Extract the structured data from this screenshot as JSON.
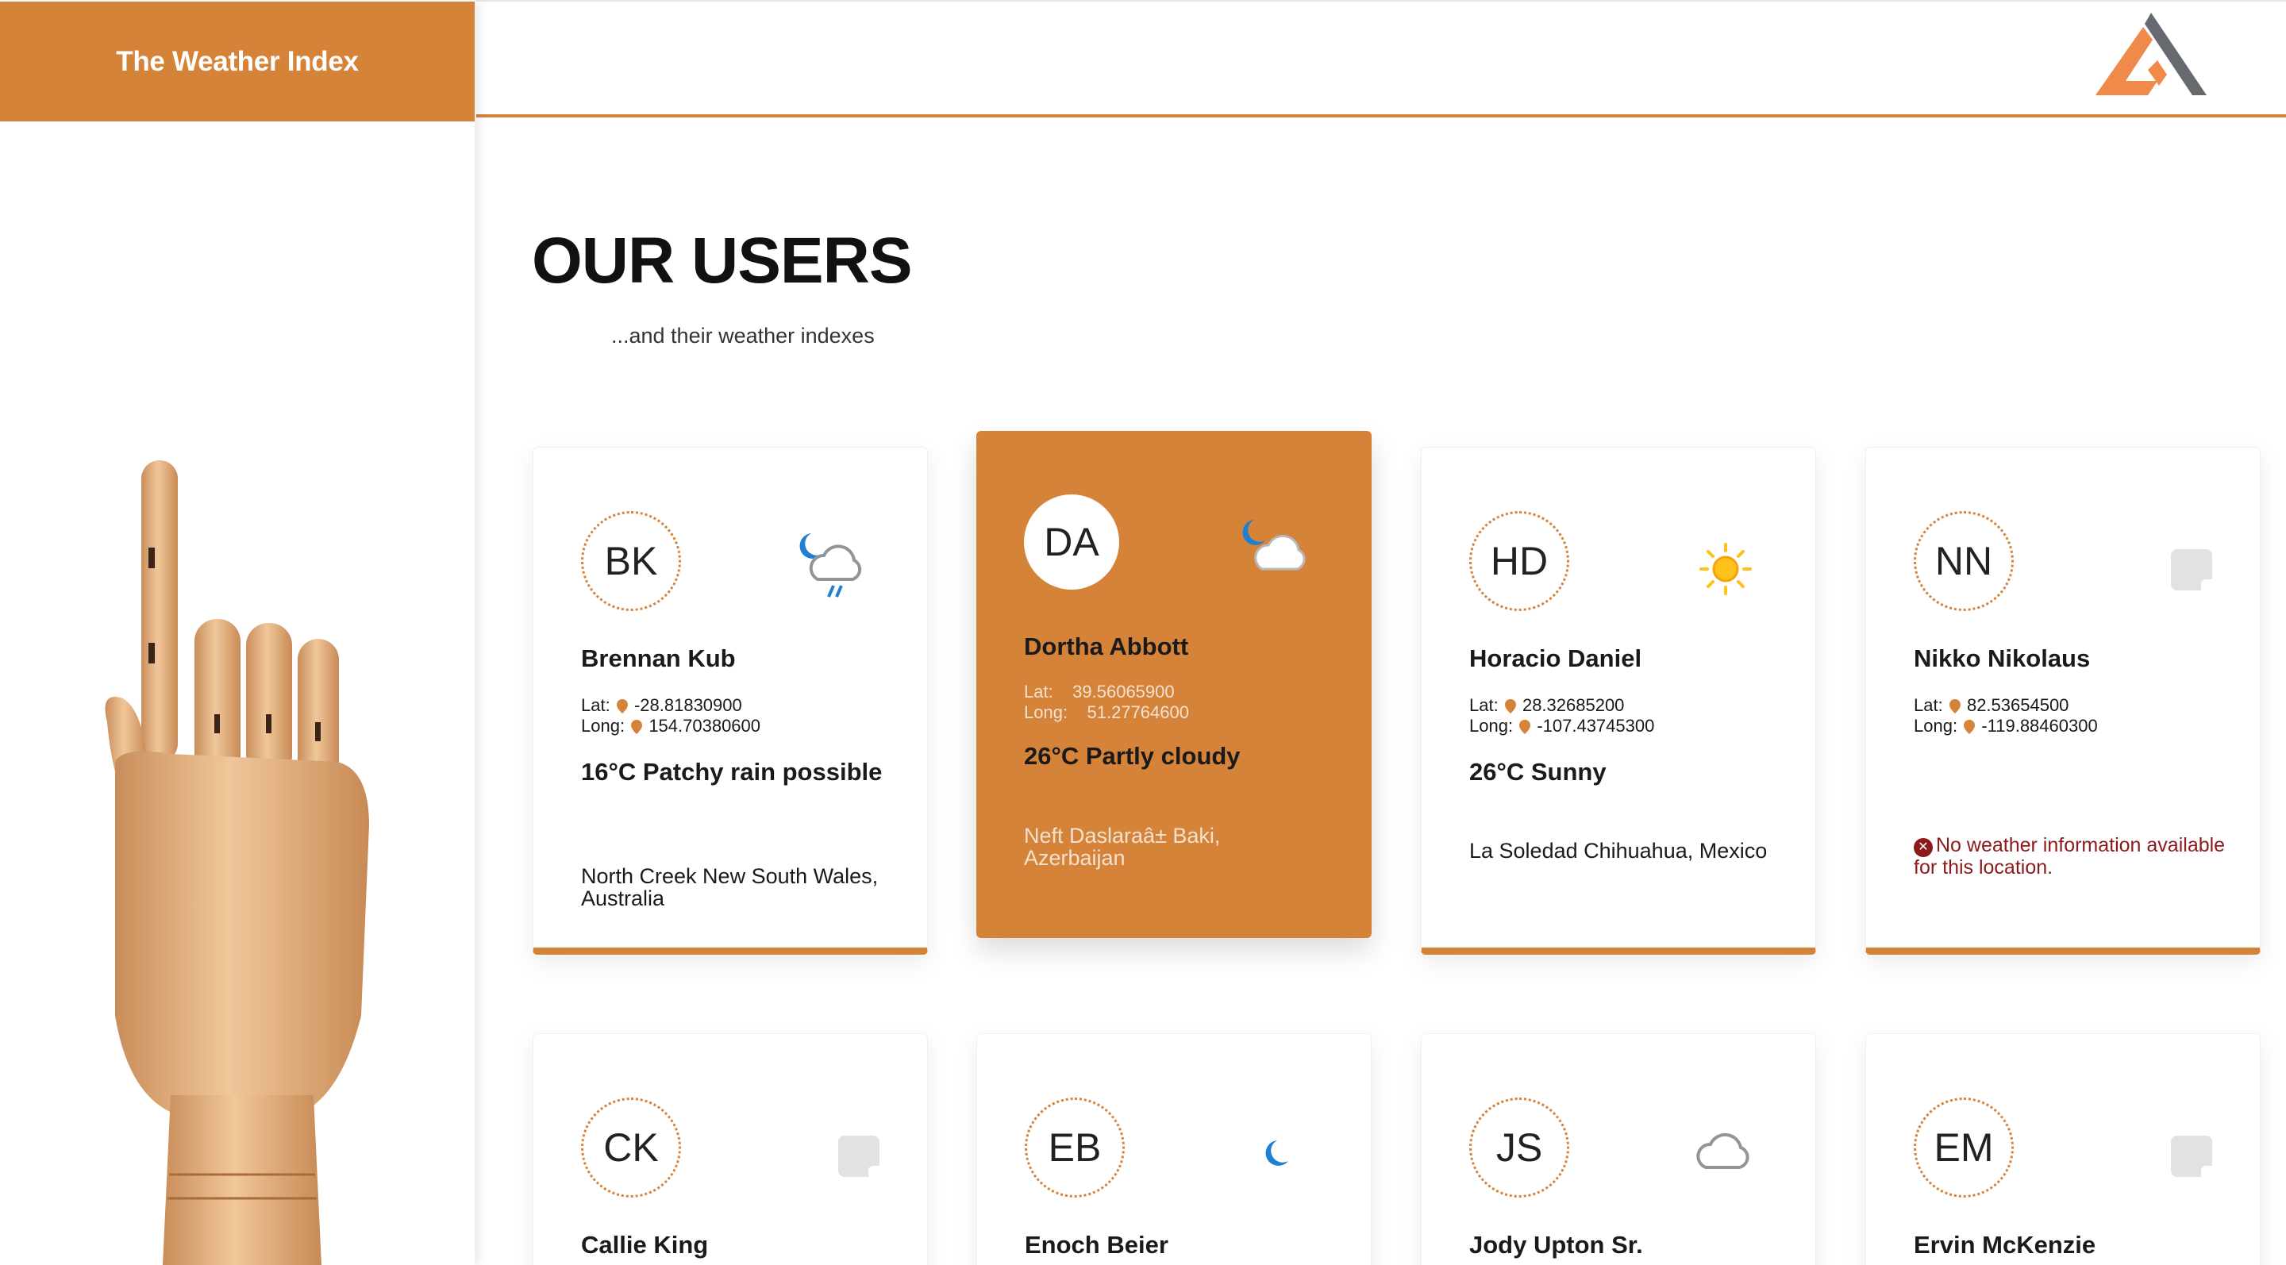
{
  "app": {
    "title": "The Weather Index"
  },
  "page": {
    "title": "OUR USERS",
    "subtitle": "...and their weather indexes"
  },
  "labels": {
    "lat": "Lat:",
    "long": "Long:"
  },
  "colors": {
    "accent": "#d6833a",
    "error": "#8b1a1a"
  },
  "users": [
    {
      "initials": "BK",
      "name": "Brennan Kub",
      "lat": "-28.81830900",
      "long": "154.70380600",
      "forecast": "16°C Patchy rain possible",
      "location": "North Creek New South Wales, Australia",
      "icon": "moon-cloud-rain-icon"
    },
    {
      "initials": "DA",
      "name": "Dortha Abbott",
      "lat": "39.56065900",
      "long": "51.27764600",
      "forecast": "26°C Partly cloudy",
      "location": "Neft Daslaraâ± Baki, Azerbaijan",
      "icon": "moon-cloud-icon"
    },
    {
      "initials": "HD",
      "name": "Horacio Daniel",
      "lat": "28.32685200",
      "long": "-107.43745300",
      "forecast": "26°C Sunny",
      "location": "La Soledad Chihuahua, Mexico",
      "icon": "sun-icon"
    },
    {
      "initials": "NN",
      "name": "Nikko Nikolaus",
      "lat": "82.53654500",
      "long": "-119.88460300",
      "error": "No weather information available for this location.",
      "icon": "no-image-icon"
    },
    {
      "initials": "CK",
      "name": "Callie King",
      "icon": "no-image-icon"
    },
    {
      "initials": "EB",
      "name": "Enoch Beier",
      "icon": "moon-icon"
    },
    {
      "initials": "JS",
      "name": "Jody Upton Sr.",
      "icon": "cloud-icon"
    },
    {
      "initials": "EM",
      "name": "Ervin McKenzie",
      "icon": "no-image-icon"
    }
  ]
}
